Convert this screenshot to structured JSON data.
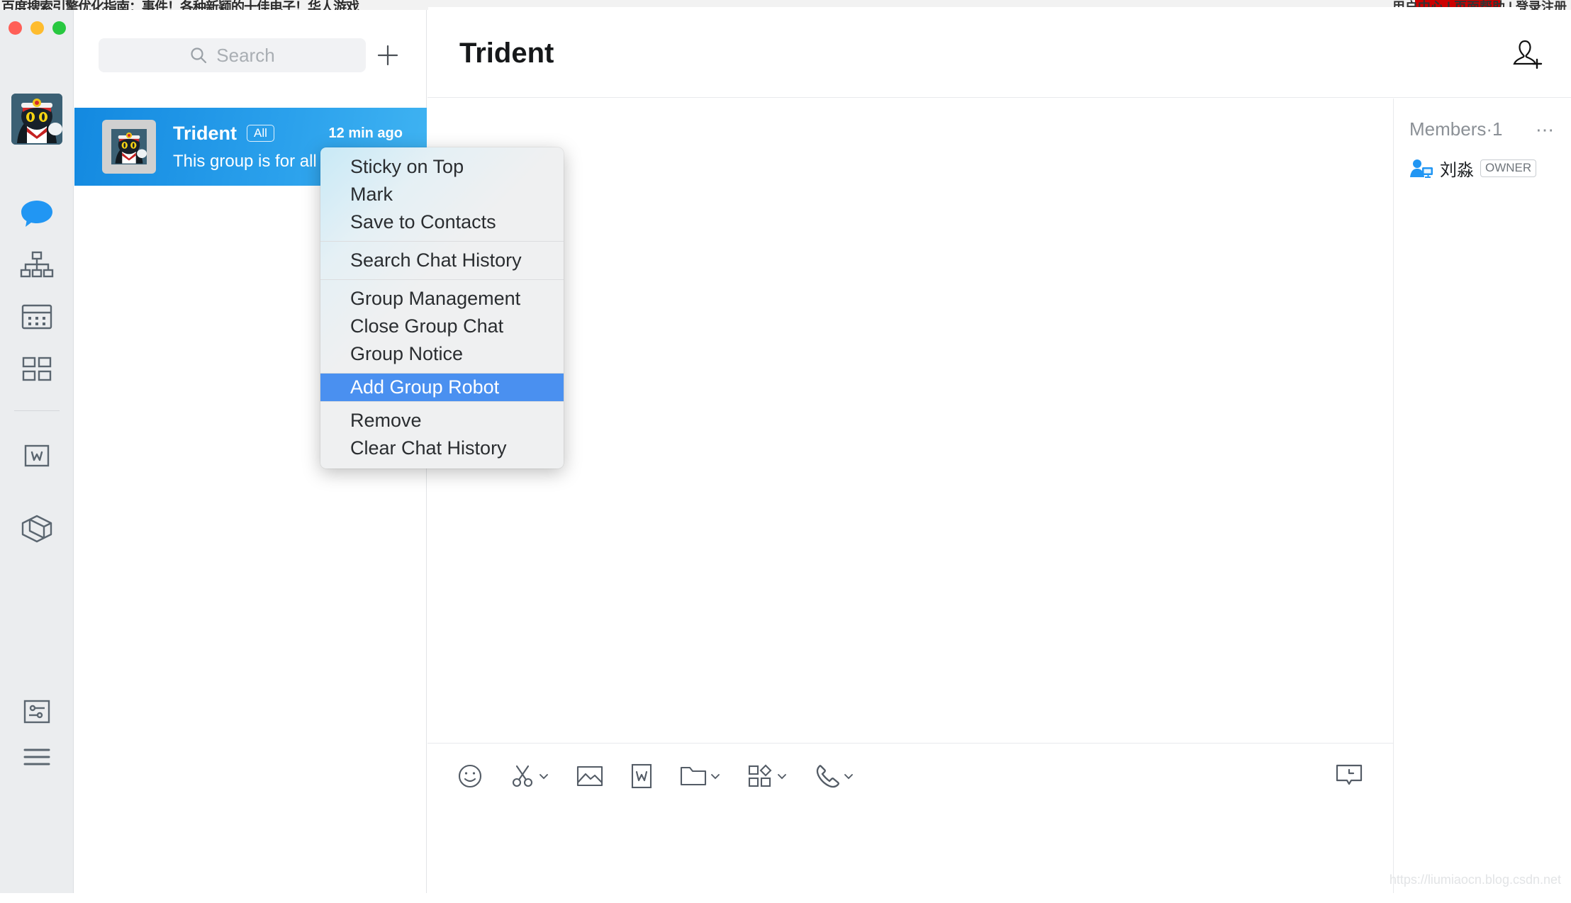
{
  "background_strip": {
    "left_text": "百度搜索引擎优化指南：事件！各种新颖的十佳电子！华人游戏",
    "right_text": "用户中心  |  页面帮助  |  登录注册",
    "watermark": ""
  },
  "window": {
    "traffic_lights": [
      "close",
      "minimize",
      "zoom"
    ]
  },
  "rail": {
    "avatar_alt": "user-avatar",
    "items": [
      {
        "name": "messages",
        "icon": "chat-bubble-icon",
        "active": true
      },
      {
        "name": "contacts",
        "icon": "org-chart-icon",
        "active": false
      },
      {
        "name": "calendar",
        "icon": "calendar-icon",
        "active": false
      },
      {
        "name": "workbench",
        "icon": "grid-apps-icon",
        "active": false
      },
      {
        "name": "documents",
        "icon": "w-document-icon",
        "active": false
      },
      {
        "name": "drive",
        "icon": "cube-box-icon",
        "active": false
      }
    ],
    "bottom_items": [
      {
        "name": "settings",
        "icon": "sliders-icon"
      },
      {
        "name": "more",
        "icon": "hamburger-menu-icon"
      }
    ]
  },
  "search": {
    "placeholder": "Search",
    "icon": "search-icon",
    "add_icon": "plus-icon"
  },
  "chat_list": [
    {
      "name": "Trident",
      "tag": "All",
      "time": "12 min ago",
      "preview": "This group is for all",
      "selected": true
    }
  ],
  "header": {
    "title": "Trident",
    "add_member_icon": "add-person-icon"
  },
  "composer": {
    "tools": [
      {
        "name": "emoji",
        "icon": "smiley-icon",
        "chevron": false
      },
      {
        "name": "screenshot",
        "icon": "scissors-icon",
        "chevron": true
      },
      {
        "name": "image",
        "icon": "picture-icon",
        "chevron": false
      },
      {
        "name": "document",
        "icon": "w-document-icon",
        "chevron": false
      },
      {
        "name": "file",
        "icon": "folder-icon",
        "chevron": true
      },
      {
        "name": "apps",
        "icon": "grid-apps-icon",
        "chevron": true
      },
      {
        "name": "call",
        "icon": "phone-icon",
        "chevron": true
      }
    ],
    "right_tool": {
      "name": "chat-history",
      "icon": "history-bubble-icon"
    },
    "input_value": "",
    "input_placeholder": ""
  },
  "members_panel": {
    "title": "Members·1",
    "more_icon": "ellipsis-icon",
    "members": [
      {
        "name": "刘淼",
        "badge": "OWNER",
        "icon": "member-avatar-icon"
      }
    ]
  },
  "context_menu": {
    "groups": [
      {
        "items": [
          {
            "label": "Sticky on Top",
            "selected": false
          },
          {
            "label": "Mark",
            "selected": false
          },
          {
            "label": "Save to Contacts",
            "selected": false
          }
        ]
      },
      {
        "items": [
          {
            "label": "Search Chat History",
            "selected": false
          }
        ]
      },
      {
        "items": [
          {
            "label": "Group Management",
            "selected": false
          },
          {
            "label": "Close Group Chat",
            "selected": false
          },
          {
            "label": "Group Notice",
            "selected": false
          }
        ]
      },
      {
        "items": [
          {
            "label": "Add Group Robot",
            "selected": true
          }
        ]
      },
      {
        "items": [
          {
            "label": "Remove",
            "selected": false
          },
          {
            "label": "Clear Chat History",
            "selected": false
          }
        ]
      }
    ],
    "selected_color": "#4a90f0"
  },
  "watermark": {
    "text": "https://liumiaocn.blog.csdn.net"
  },
  "colors": {
    "accent": "#2196f3",
    "selected_chat": "#1389e0",
    "menu_highlight": "#4a90f0",
    "rail_bg": "#ebedef"
  }
}
